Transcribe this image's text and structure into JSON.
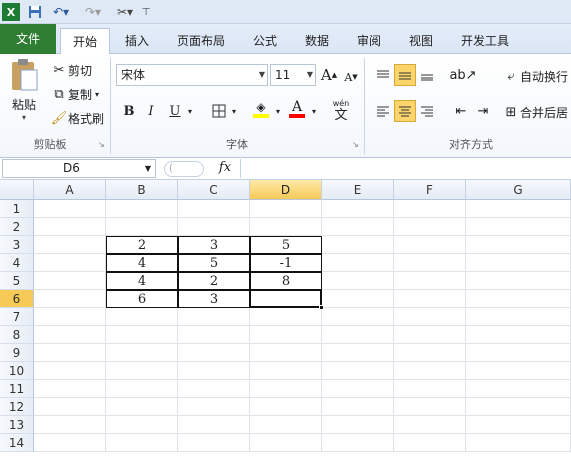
{
  "qat": {
    "app_icon": "excel-icon",
    "save": "save-icon",
    "undo": "undo-icon",
    "redo": "redo-icon",
    "tools": "tools-icon",
    "more": "customize-icon"
  },
  "tabs": [
    "文件",
    "开始",
    "插入",
    "页面布局",
    "公式",
    "数据",
    "审阅",
    "视图",
    "开发工具"
  ],
  "clipboard": {
    "paste": "粘贴",
    "cut": "剪切",
    "copy": "复制",
    "format_painter": "格式刷",
    "label": "剪贴板"
  },
  "font": {
    "name": "宋体",
    "size": "11",
    "bold": "B",
    "italic": "I",
    "underline": "U",
    "grow": "A",
    "shrink": "A",
    "wen": "wén",
    "wen_char": "文",
    "label": "字体",
    "fill_color": "#ffff00",
    "font_color": "#ff0000"
  },
  "alignment": {
    "wrap": "自动换行",
    "merge": "合并后居",
    "label": "对齐方式"
  },
  "formula_bar": {
    "name_box": "D6",
    "fx": "fx",
    "value": ""
  },
  "columns": [
    "A",
    "B",
    "C",
    "D",
    "E",
    "F",
    "G"
  ],
  "rows": [
    "1",
    "2",
    "3",
    "4",
    "5",
    "6",
    "7",
    "8",
    "9",
    "10",
    "11",
    "12",
    "13",
    "14"
  ],
  "cells": {
    "B3": "2",
    "C3": "3",
    "D3": "5",
    "B4": "4",
    "C4": "5",
    "D4": "-1",
    "B5": "4",
    "C5": "2",
    "D5": "8",
    "B6": "6",
    "C6": "3",
    "D6": ""
  },
  "selected": {
    "column": "D",
    "row": "6"
  }
}
